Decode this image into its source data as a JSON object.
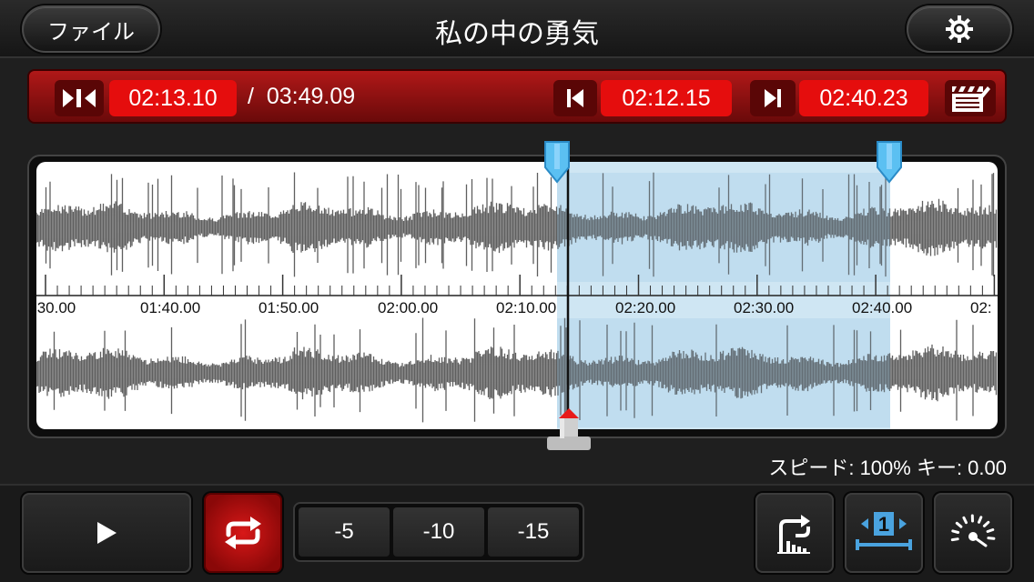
{
  "header": {
    "file_label": "ファイル",
    "title": "私の中の勇気"
  },
  "timebar": {
    "current_time": "02:13.10",
    "slash": "/",
    "total_time": "03:49.09",
    "loop_start": "02:12.15",
    "loop_end": "02:40.23"
  },
  "waveform": {
    "tick_labels": [
      ":30.00",
      "01:40.00",
      "01:50.00",
      "02:00.00",
      "02:10.00",
      "02:20.00",
      "02:30.00",
      "02:40.00",
      "02:"
    ],
    "selection_color": "#cfe6f3"
  },
  "status": {
    "speed_key": "スピード: 100% キー: 0.00"
  },
  "controls": {
    "skip_5": "-5",
    "skip_10": "-10",
    "skip_15": "-15",
    "loop_active_color": "#c01010"
  }
}
